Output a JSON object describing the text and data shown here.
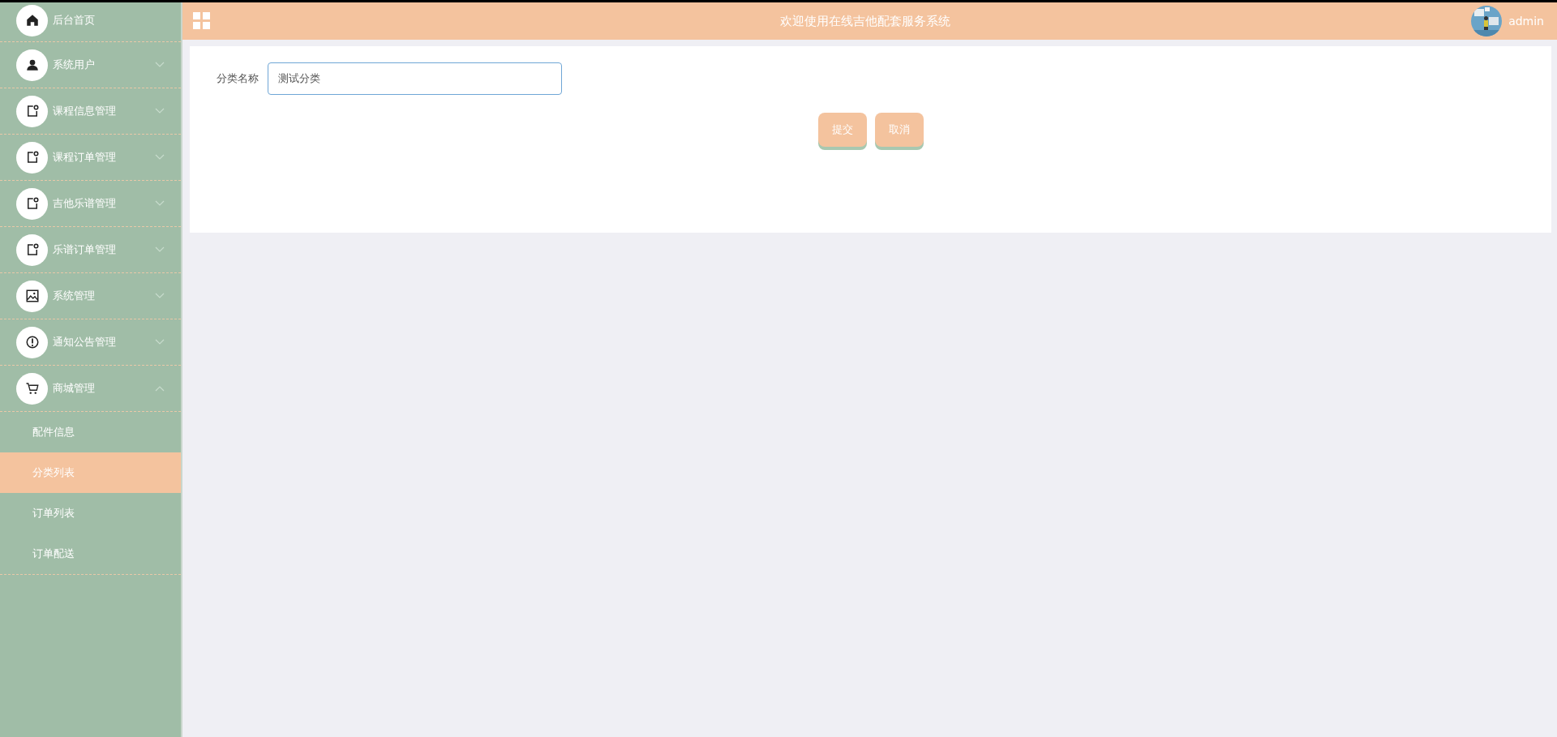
{
  "sidebar": {
    "items": [
      {
        "label": "后台首页",
        "kind": "link"
      },
      {
        "label": "系统用户",
        "kind": "menu",
        "expanded": false
      },
      {
        "label": "课程信息管理",
        "kind": "menu",
        "expanded": false
      },
      {
        "label": "课程订单管理",
        "kind": "menu",
        "expanded": false
      },
      {
        "label": "吉他乐谱管理",
        "kind": "menu",
        "expanded": false
      },
      {
        "label": "乐谱订单管理",
        "kind": "menu",
        "expanded": false
      },
      {
        "label": "系统管理",
        "kind": "menu",
        "expanded": false
      },
      {
        "label": "通知公告管理",
        "kind": "menu",
        "expanded": false
      },
      {
        "label": "商城管理",
        "kind": "menu",
        "expanded": true,
        "children": [
          {
            "label": "配件信息",
            "selected": false
          },
          {
            "label": "分类列表",
            "selected": true
          },
          {
            "label": "订单列表",
            "selected": false
          },
          {
            "label": "订单配送",
            "selected": false
          }
        ]
      }
    ]
  },
  "header": {
    "title": "欢迎使用在线吉他配套服务系统",
    "user": "admin"
  },
  "form": {
    "fields": [
      {
        "label": "分类名称",
        "value": "测试分类"
      }
    ],
    "buttons": [
      "提交",
      "取消"
    ]
  }
}
